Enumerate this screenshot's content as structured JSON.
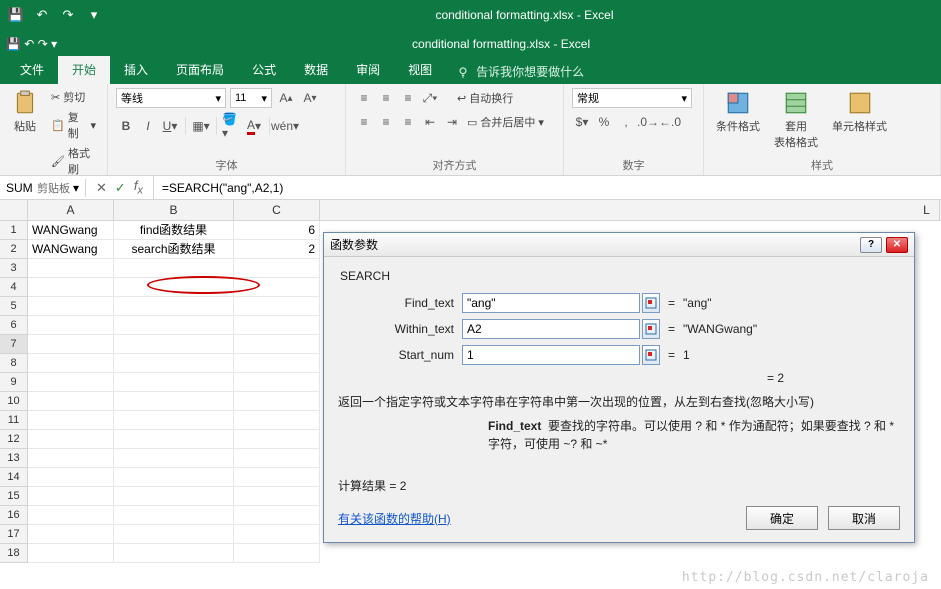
{
  "title1": "conditional formatting.xlsx - Excel",
  "title2": "conditional formatting.xlsx - Excel",
  "tabs": {
    "file": "文件",
    "home": "开始",
    "insert": "插入",
    "layout": "页面布局",
    "formulas": "公式",
    "data": "数据",
    "review": "审阅",
    "view": "视图",
    "tell": "告诉我你想要做什么"
  },
  "ribbon": {
    "clipboard": {
      "paste": "粘贴",
      "cut": "剪切",
      "copy": "复制",
      "format": "格式刷",
      "label": "剪贴板"
    },
    "font": {
      "name": "等线",
      "size": "11",
      "label": "字体"
    },
    "align": {
      "wrap": "自动换行",
      "merge": "合并后居中",
      "label": "对齐方式"
    },
    "number": {
      "format": "常规",
      "label": "数字"
    },
    "styles": {
      "cond": "条件格式",
      "table": "套用\n表格格式",
      "cell": "单元格样式",
      "label": "样式"
    }
  },
  "namebox": "SUM",
  "formula": "=SEARCH(\"ang\",A2,1)",
  "cols": [
    "A",
    "B",
    "C",
    "L"
  ],
  "cells": {
    "A1": "WANGwang",
    "B1": "find函数结果",
    "C1": "6",
    "A2": "WANGwang",
    "B2": "search函数结果",
    "C2": "2"
  },
  "dialog": {
    "title": "函数参数",
    "fn": "SEARCH",
    "args": {
      "find_label": "Find_text",
      "find_val": "\"ang\"",
      "find_res": "\"ang\"",
      "within_label": "Within_text",
      "within_val": "A2",
      "within_res": "\"WANGwang\"",
      "start_label": "Start_num",
      "start_val": "1",
      "start_res": "1"
    },
    "eqsym": "=",
    "preview": "=   2",
    "desc": "返回一个指定字符或文本字符串在字符串中第一次出现的位置，从左到右查找(忽略大小写)",
    "arg_help_label": "Find_text",
    "arg_help": "要查找的字符串。可以使用 ? 和 * 作为通配符；如果要查找 ? 和 * 字符，可使用 ~? 和 ~*",
    "result_label": "计算结果 = ",
    "result_val": "2",
    "help_link": "有关该函数的帮助(H)",
    "ok": "确定",
    "cancel": "取消"
  },
  "watermark": "http://blog.csdn.net/claroja"
}
